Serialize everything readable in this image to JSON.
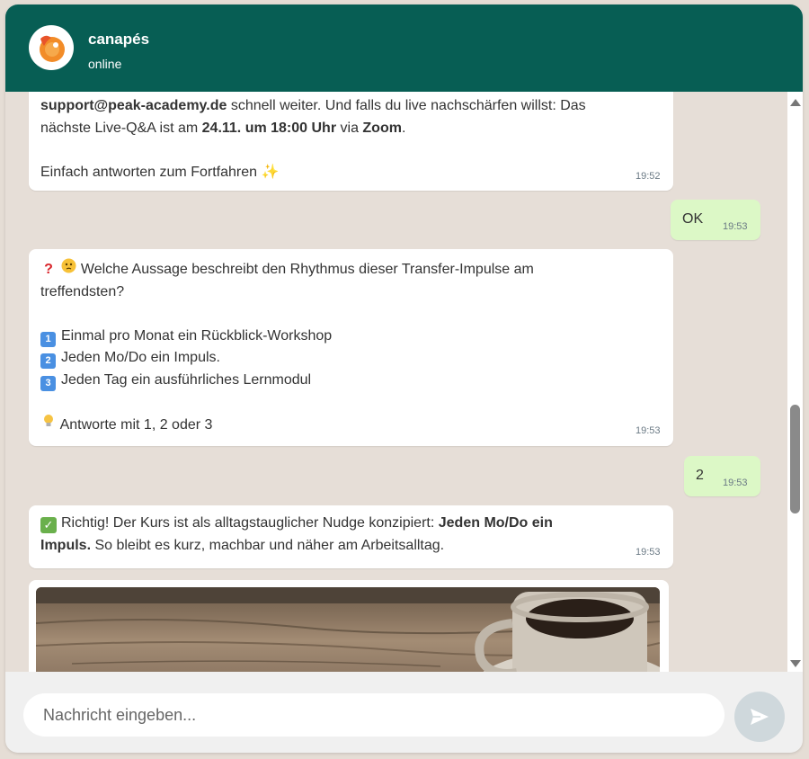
{
  "header": {
    "title": "canapés",
    "status": "online"
  },
  "messages": [
    {
      "direction": "in",
      "line1_email": "support@peak-academy.de",
      "line1_rest": " schnell weiter. Und falls du live nachschärfen willst: Das",
      "line2_a": "nächste Live-Q&A ist am ",
      "line2_date": "24.11. um 18:00 Uhr",
      "line2_b": " via ",
      "line2_zoom": "Zoom",
      "line2_c": ".",
      "line3": "Einfach antworten zum Fortfahren ✨",
      "time": "19:52"
    },
    {
      "direction": "out",
      "text": "OK",
      "time": "19:53"
    },
    {
      "direction": "in",
      "question_line1": "Welche Aussage beschreibt den Rhythmus dieser Transfer-Impulse am",
      "question_line2": "treffendsten?",
      "options": [
        {
          "key": "1",
          "text": "Einmal pro Monat ein Rückblick-Workshop"
        },
        {
          "key": "2",
          "text": "Jeden Mo/Do ein Impuls."
        },
        {
          "key": "3",
          "text": "Jeden Tag ein ausführliches Lernmodul"
        }
      ],
      "hint": "Antworte mit 1, 2 oder 3",
      "time": "19:53"
    },
    {
      "direction": "out",
      "text": "2",
      "time": "19:53"
    },
    {
      "direction": "in",
      "a": "Richtig! Der Kurs ist als alltagstauglicher Nudge konzipiert: ",
      "b": "Jeden Mo/Do ein",
      "c": "Impuls.",
      "d": " So bleibt es kurz, machbar und näher am Arbeitsalltag.",
      "time": "19:53"
    }
  ],
  "composer": {
    "placeholder": "Nachricht eingeben..."
  },
  "icons": {
    "avatar": "canapes-logo",
    "send": "send-icon",
    "question": "question-mark-icon",
    "thinking": "thinking-face-icon",
    "hint": "light-bulb-icon",
    "correct": "check-mark-icon"
  },
  "colors": {
    "header": "#075e54",
    "outgoing_bubble": "#dcf8c6",
    "chat_background": "#e5ddd5"
  }
}
